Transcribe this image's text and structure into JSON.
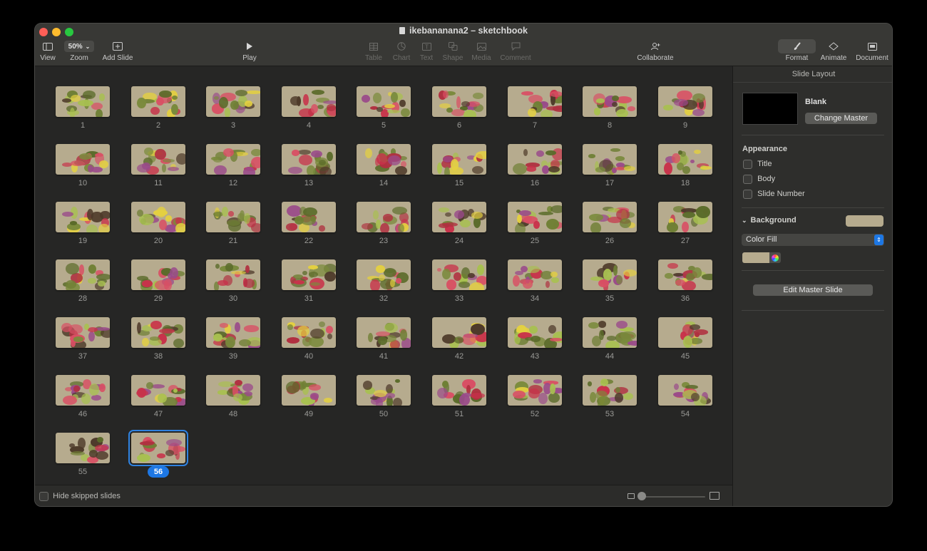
{
  "window": {
    "title": "ikebananana2 – sketchbook"
  },
  "traffic_lights": {
    "close": "#ff5f57",
    "minimize": "#febc2e",
    "zoom": "#28c840"
  },
  "toolbar": {
    "view_label": "View",
    "zoom_value": "50%",
    "zoom_label": "Zoom",
    "add_slide_label": "Add Slide",
    "play_label": "Play",
    "table_label": "Table",
    "chart_label": "Chart",
    "text_label": "Text",
    "shape_label": "Shape",
    "media_label": "Media",
    "comment_label": "Comment",
    "collaborate_label": "Collaborate",
    "format_label": "Format",
    "animate_label": "Animate",
    "document_label": "Document"
  },
  "slides": {
    "count": 56,
    "selected": 56,
    "thumb_background": "#b6ab8e",
    "numbers": [
      "1",
      "2",
      "3",
      "4",
      "5",
      "6",
      "7",
      "8",
      "9",
      "10",
      "11",
      "12",
      "13",
      "14",
      "15",
      "16",
      "17",
      "18",
      "19",
      "20",
      "21",
      "22",
      "23",
      "24",
      "25",
      "26",
      "27",
      "28",
      "29",
      "30",
      "31",
      "32",
      "33",
      "34",
      "35",
      "36",
      "37",
      "38",
      "39",
      "40",
      "41",
      "42",
      "43",
      "44",
      "45",
      "46",
      "47",
      "48",
      "49",
      "50",
      "51",
      "52",
      "53",
      "54",
      "55",
      "56"
    ]
  },
  "footer": {
    "hide_skipped_label": "Hide skipped slides",
    "hide_skipped_checked": false
  },
  "sidebar": {
    "header": "Slide Layout",
    "master_name": "Blank",
    "change_master_label": "Change Master",
    "appearance_heading": "Appearance",
    "appearance_options": [
      {
        "label": "Title",
        "checked": false
      },
      {
        "label": "Body",
        "checked": false
      },
      {
        "label": "Slide Number",
        "checked": false
      }
    ],
    "background_heading": "Background",
    "fill_type": "Color Fill",
    "fill_color": "#b6ab8e",
    "edit_master_label": "Edit Master Slide"
  },
  "accent_color": "#1d77e4"
}
